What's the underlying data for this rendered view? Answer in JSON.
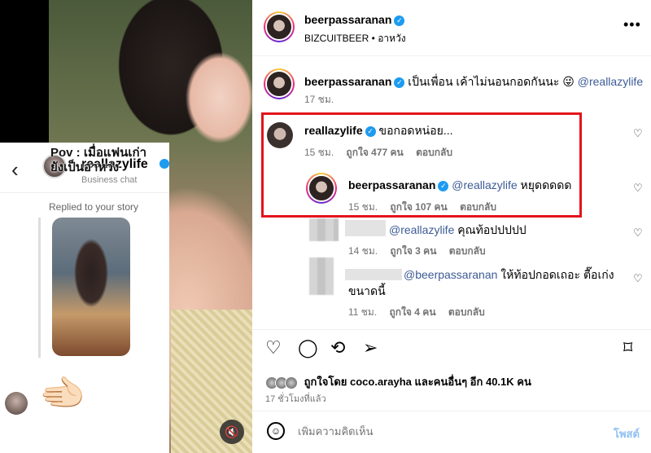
{
  "chat": {
    "overlay_text": "Pov : เมื่อแฟนเก่า\nยังเป็นอาหว่ง",
    "username": "reallazylife",
    "subtitle": "Business chat",
    "replied_label": "Replied to your story",
    "emoji": "🫲🏻"
  },
  "post": {
    "username": "beerpassaranan",
    "subtitle": "BIZCUITBEER • อาหวัง",
    "more": "•••",
    "caption": {
      "username": "beerpassaranan",
      "text": "เป็นเพื่อน เค้าไม่นอนกอดกันนะ 😜",
      "mention": "@reallazylife",
      "time": "17 ชม."
    },
    "comments": [
      {
        "username": "reallazylife",
        "text": "ขอกอดหน่อย...",
        "time": "15 ชม.",
        "likes": "ถูกใจ 477 คน",
        "reply": "ตอบกลับ"
      },
      {
        "username": "beerpassaranan",
        "mention": "@reallazylife",
        "text": "หยุดดดดด",
        "time": "15 ชม.",
        "likes": "ถูกใจ 107 คน",
        "reply": "ตอบกลับ"
      },
      {
        "mention": "@reallazylife",
        "text": "คุณท้อปปปปป",
        "time": "14 ชม.",
        "likes": "ถูกใจ 3 คน",
        "reply": "ตอบกลับ"
      },
      {
        "mention": "@beerpassaranan",
        "text": "ให้ท้อปกอดเถอะ ตื๊อเก่งขนาดนี้",
        "time": "11 ชม.",
        "likes": "ถูกใจ 4 คน",
        "reply": "ตอบกลับ"
      }
    ],
    "liked_by": "ถูกใจโดย coco.arayha และคนอื่นๆ อีก 40.1K คน",
    "ago": "17 ชั่วโมงที่แล้ว",
    "add_comment_placeholder": "เพิ่มความคิดเห็น",
    "post_label": "โพสต์"
  },
  "colors": {
    "highlight": "#e3141b",
    "mention": "#3d5b96",
    "verified": "#1d9bf0"
  },
  "icons": [
    "heart-icon",
    "comment-icon",
    "repost-icon",
    "share-icon",
    "bookmark-icon",
    "emoji-icon",
    "mute-icon",
    "back-icon",
    "more-icon"
  ]
}
